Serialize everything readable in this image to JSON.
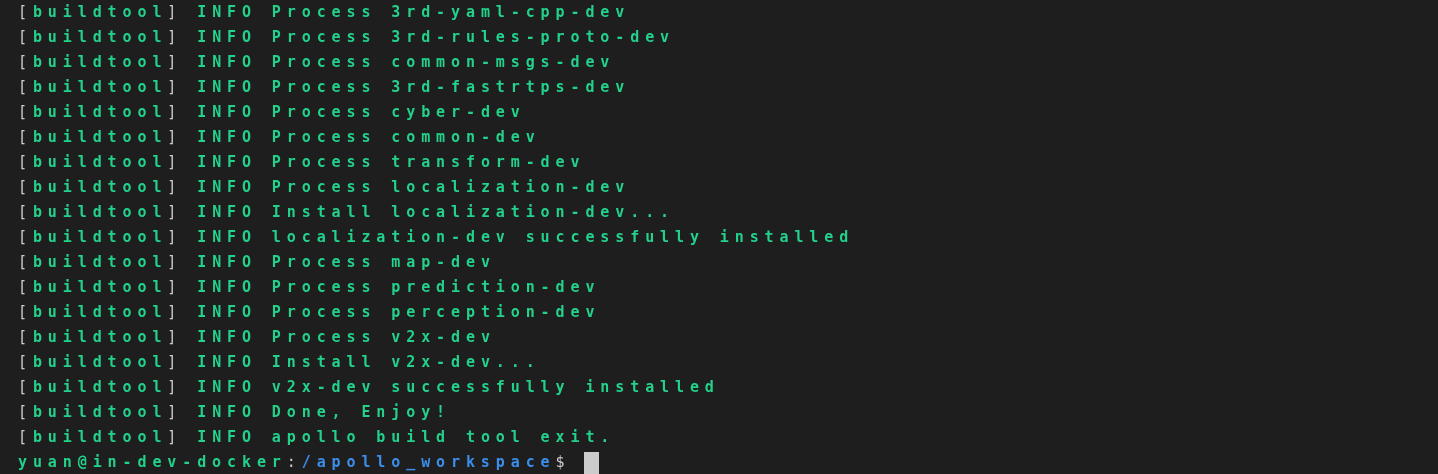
{
  "terminal": {
    "lines": [
      {
        "open": "[",
        "tag": "buildtool",
        "close": "]",
        "message": "INFO Process 3rd-yaml-cpp-dev"
      },
      {
        "open": "[",
        "tag": "buildtool",
        "close": "]",
        "message": "INFO Process 3rd-rules-proto-dev"
      },
      {
        "open": "[",
        "tag": "buildtool",
        "close": "]",
        "message": "INFO Process common-msgs-dev"
      },
      {
        "open": "[",
        "tag": "buildtool",
        "close": "]",
        "message": "INFO Process 3rd-fastrtps-dev"
      },
      {
        "open": "[",
        "tag": "buildtool",
        "close": "]",
        "message": "INFO Process cyber-dev"
      },
      {
        "open": "[",
        "tag": "buildtool",
        "close": "]",
        "message": "INFO Process common-dev"
      },
      {
        "open": "[",
        "tag": "buildtool",
        "close": "]",
        "message": "INFO Process transform-dev"
      },
      {
        "open": "[",
        "tag": "buildtool",
        "close": "]",
        "message": "INFO Process localization-dev"
      },
      {
        "open": "[",
        "tag": "buildtool",
        "close": "]",
        "message": "INFO Install localization-dev..."
      },
      {
        "open": "[",
        "tag": "buildtool",
        "close": "]",
        "message": "INFO localization-dev successfully installed"
      },
      {
        "open": "[",
        "tag": "buildtool",
        "close": "]",
        "message": "INFO Process map-dev"
      },
      {
        "open": "[",
        "tag": "buildtool",
        "close": "]",
        "message": "INFO Process prediction-dev"
      },
      {
        "open": "[",
        "tag": "buildtool",
        "close": "]",
        "message": "INFO Process perception-dev"
      },
      {
        "open": "[",
        "tag": "buildtool",
        "close": "]",
        "message": "INFO Process v2x-dev"
      },
      {
        "open": "[",
        "tag": "buildtool",
        "close": "]",
        "message": "INFO Install v2x-dev..."
      },
      {
        "open": "[",
        "tag": "buildtool",
        "close": "]",
        "message": "INFO v2x-dev successfully installed"
      },
      {
        "open": "[",
        "tag": "buildtool",
        "close": "]",
        "message": "INFO Done, Enjoy!"
      },
      {
        "open": "[",
        "tag": "buildtool",
        "close": "]",
        "message": "INFO apollo build tool exit."
      }
    ],
    "prompt": {
      "user_host": "yuan@in-dev-docker",
      "separator": ":",
      "path": "/apollo_workspace",
      "symbol": "$"
    }
  }
}
